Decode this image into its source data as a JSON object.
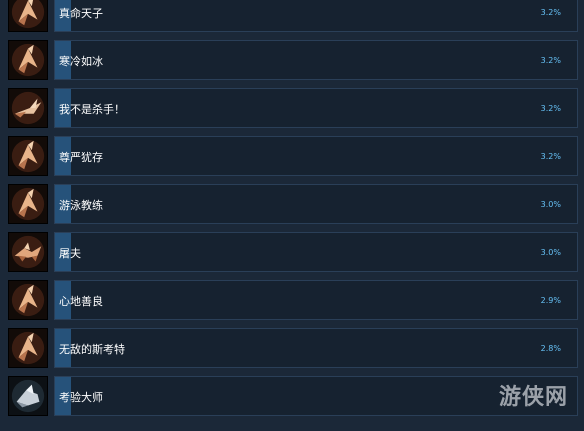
{
  "achievements": [
    {
      "name": "真命天子",
      "percent": "3.2%",
      "icon": "origami-bird-icon",
      "fill": 0.032
    },
    {
      "name": "寒冷如冰",
      "percent": "3.2%",
      "icon": "origami-bird-icon",
      "fill": 0.032
    },
    {
      "name": "我不是杀手！",
      "percent": "3.2%",
      "icon": "origami-swan-icon",
      "fill": 0.032
    },
    {
      "name": "尊严犹存",
      "percent": "3.2%",
      "icon": "origami-bird-icon",
      "fill": 0.032
    },
    {
      "name": "游泳教练",
      "percent": "3.0%",
      "icon": "origami-bird-icon",
      "fill": 0.03
    },
    {
      "name": "屠夫",
      "percent": "3.0%",
      "icon": "origami-beast-icon",
      "fill": 0.03
    },
    {
      "name": "心地善良",
      "percent": "2.9%",
      "icon": "origami-bird-icon",
      "fill": 0.029
    },
    {
      "name": "无敌的斯考特",
      "percent": "2.8%",
      "icon": "origami-bird-icon",
      "fill": 0.028
    },
    {
      "name": "考验大师",
      "percent": "",
      "icon": "silver-origami-icon",
      "fill": 0.028
    }
  ],
  "watermark": "游侠网",
  "colors": {
    "bar_fill": "#26527a",
    "percent_text": "#66c0f4",
    "background": "#1b2838"
  }
}
